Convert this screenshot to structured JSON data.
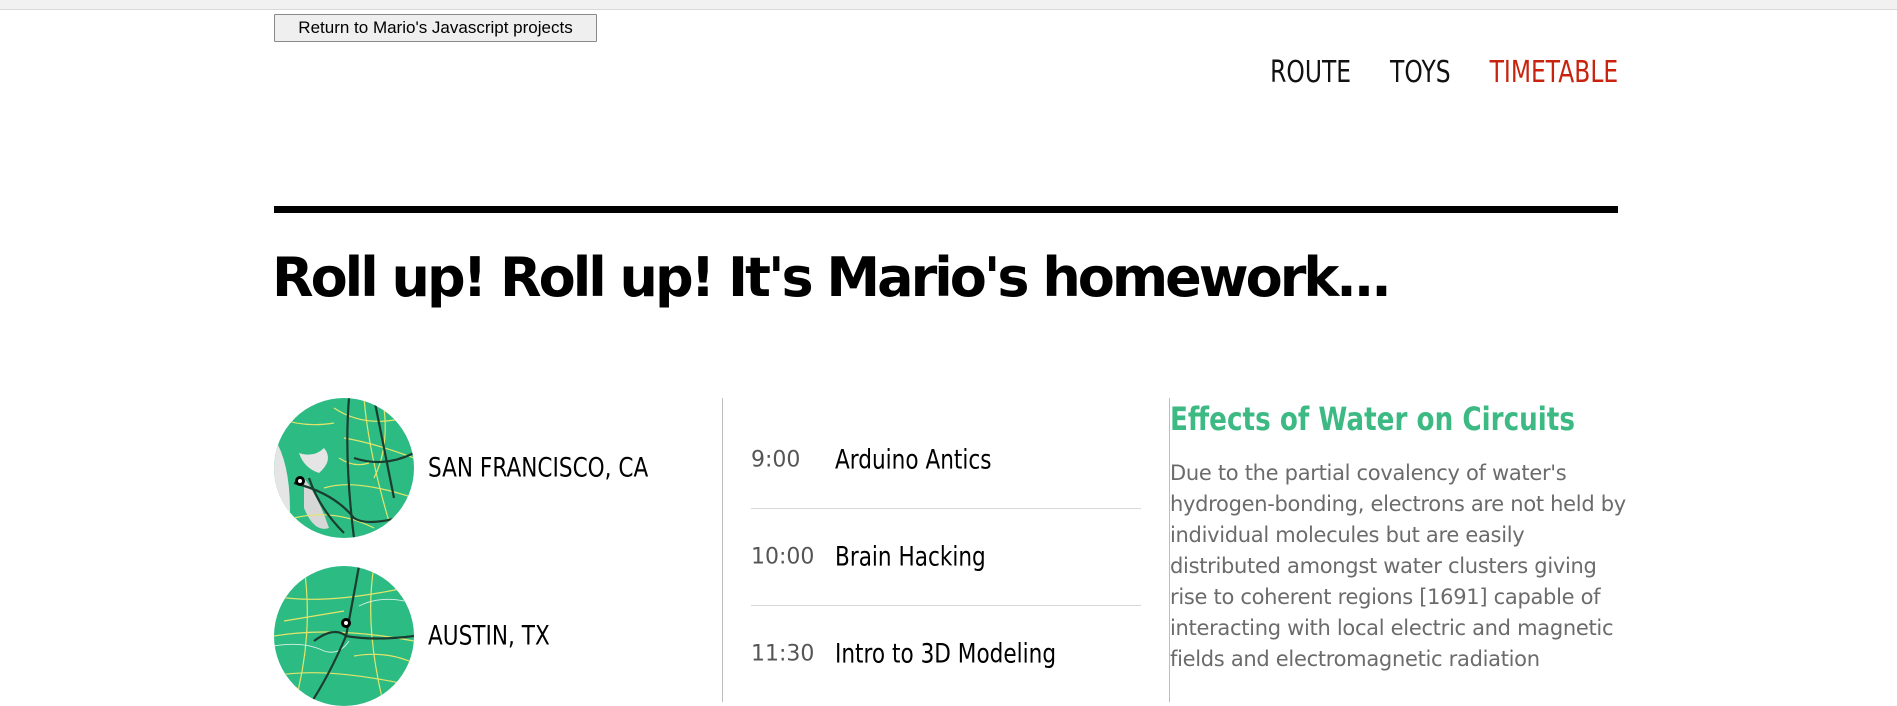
{
  "return_button": {
    "label": "Return to Mario's Javascript projects"
  },
  "nav": {
    "items": [
      "ROUTE",
      "TOYS",
      "TIMETABLE"
    ],
    "active": "TIMETABLE"
  },
  "headline": "Roll up! Roll up! It's Mario's homework...",
  "cities": [
    {
      "name": "SAN FRANCISCO, CA"
    },
    {
      "name": "AUSTIN, TX"
    }
  ],
  "schedule": [
    {
      "time": "9:00",
      "title": "Arduino Antics"
    },
    {
      "time": "10:00",
      "title": "Brain Hacking"
    },
    {
      "time": "11:30",
      "title": "Intro to 3D Modeling"
    }
  ],
  "article": {
    "title": "Effects of Water on Circuits",
    "body": "Due to the partial covalency of water's hydrogen-bonding, electrons are not held by individual molecules but are easily distributed amongst water clusters giving rise to coherent regions [1691] capable of interacting with local electric and magnetic fields and electromagnetic radiation"
  },
  "colors": {
    "accent": "#3dba84",
    "active_nav": "#c8230e",
    "map_green": "#2dbb84"
  },
  "icons": [
    "map-sanfrancisco-icon",
    "map-austin-icon"
  ]
}
